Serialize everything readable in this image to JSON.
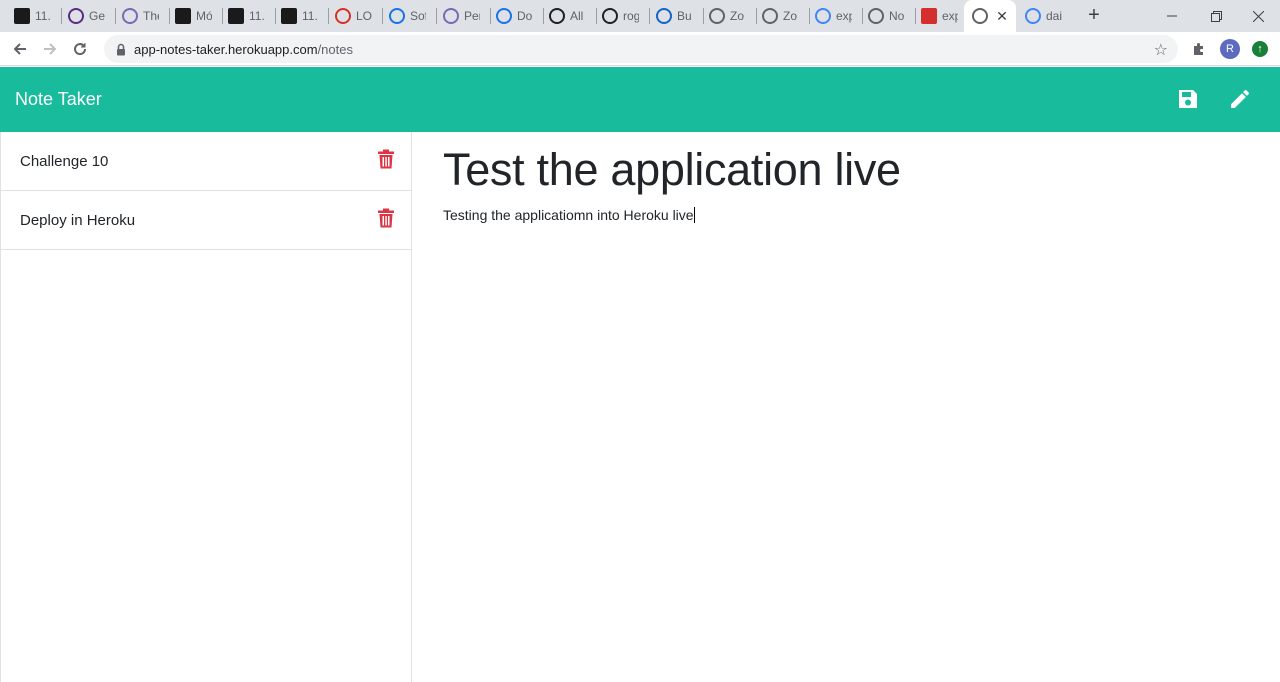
{
  "browser": {
    "tabs": [
      {
        "favicon": "dark-square-icon",
        "title": "11.",
        "color": "#1a1a1a"
      },
      {
        "favicon": "purple-circle-icon",
        "title": "Get",
        "color": "#5b2a86"
      },
      {
        "favicon": "heroku-icon",
        "title": "The",
        "color": "#7b68b5"
      },
      {
        "favicon": "dark-square-icon",
        "title": "Mó",
        "color": "#1a1a1a"
      },
      {
        "favicon": "dark-square-icon",
        "title": "11.",
        "color": "#1a1a1a"
      },
      {
        "favicon": "dark-square-icon",
        "title": "11.",
        "color": "#1a1a1a"
      },
      {
        "favicon": "gmail-icon",
        "title": "LO",
        "color": "#d93025"
      },
      {
        "favicon": "info-icon",
        "title": "Sof",
        "color": "#1a73e8"
      },
      {
        "favicon": "heroku-icon",
        "title": "Per",
        "color": "#7b68b5"
      },
      {
        "favicon": "download-icon",
        "title": "Do",
        "color": "#1a73e8"
      },
      {
        "favicon": "github-icon",
        "title": "All",
        "color": "#202124"
      },
      {
        "favicon": "github-icon",
        "title": "rog",
        "color": "#202124"
      },
      {
        "favicon": "globe-blue-icon",
        "title": "Bu",
        "color": "#1565c0"
      },
      {
        "favicon": "globe-icon",
        "title": "Zo",
        "color": "#5f6368"
      },
      {
        "favicon": "globe-icon",
        "title": "Zo",
        "color": "#5f6368"
      },
      {
        "favicon": "google-icon",
        "title": "exp",
        "color": "#4285f4"
      },
      {
        "favicon": "globe-icon",
        "title": "No",
        "color": "#5f6368"
      },
      {
        "favicon": "red-square-icon",
        "title": "exp",
        "color": "#d32f2f"
      },
      {
        "favicon": "globe-icon",
        "title": "",
        "color": "#5f6368",
        "active": true
      },
      {
        "favicon": "google-icon",
        "title": "dai",
        "color": "#4285f4"
      }
    ],
    "new_tab": "+",
    "url_host": "app-notes-taker.herokuapp.com",
    "url_path": "/notes",
    "profile_initial": "R"
  },
  "app": {
    "brand": "Note Taker",
    "accent": "#18bc9c",
    "delete_color": "#dc3545",
    "notes": [
      {
        "title": "Challenge 10"
      },
      {
        "title": "Deploy in Heroku"
      }
    ],
    "active_note": {
      "title": "Test the application live",
      "text": "Testing the applicatiomn into Heroku live"
    }
  }
}
